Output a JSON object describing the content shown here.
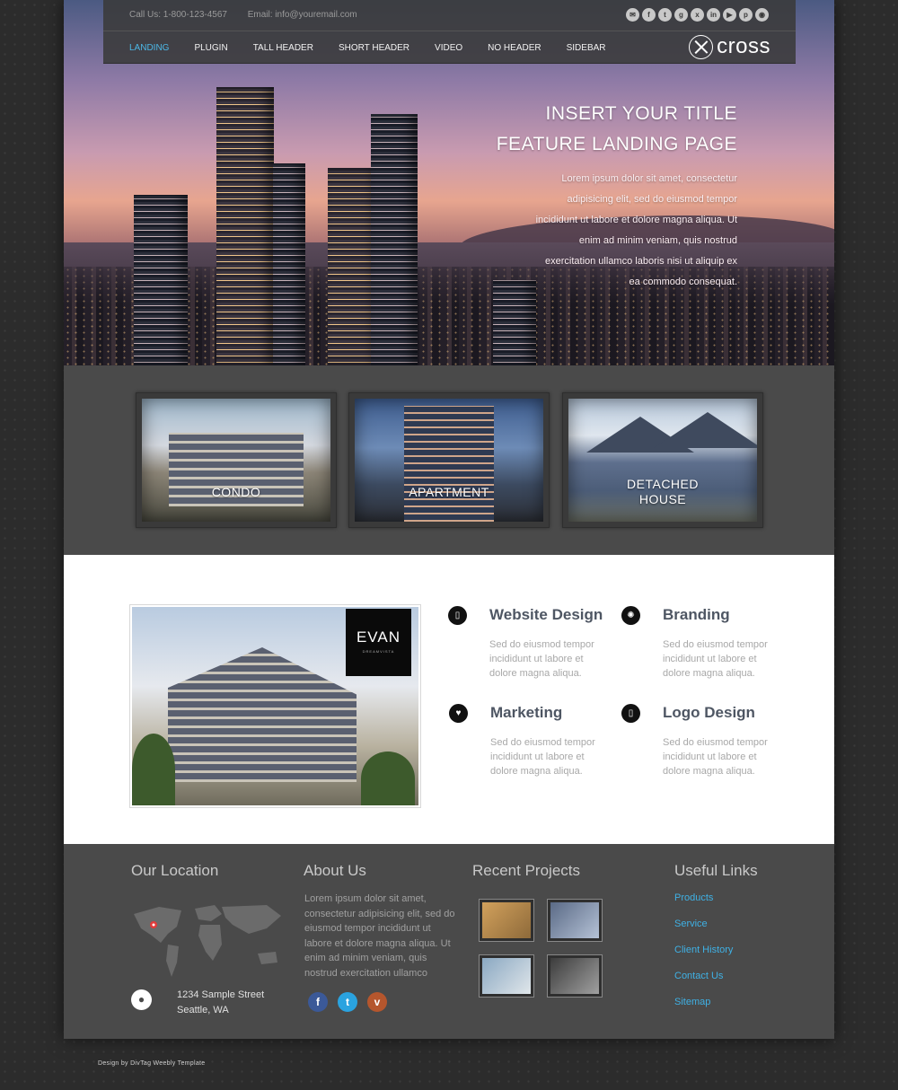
{
  "header": {
    "phone": "Call Us: 1-800-123-4567",
    "email": "Email: info@youremail.com",
    "social_icons": [
      "mail-icon",
      "facebook-icon",
      "twitter-icon",
      "google-plus-icon",
      "xing-icon",
      "linkedin-icon",
      "youtube-icon",
      "pinterest-icon",
      "rss-icon"
    ],
    "nav": [
      {
        "label": "LANDING",
        "active": true
      },
      {
        "label": "PLUGIN"
      },
      {
        "label": "TALL HEADER"
      },
      {
        "label": "SHORT HEADER"
      },
      {
        "label": "VIDEO"
      },
      {
        "label": "NO HEADER"
      },
      {
        "label": "SIDEBAR"
      }
    ],
    "logo": "cross"
  },
  "hero": {
    "title_line1": "INSERT YOUR TITLE",
    "title_line2": "FEATURE LANDING PAGE",
    "body": "Lorem ipsum dolor sit amet, consectetur adipisicing elit, sed do eiusmod tempor incididunt ut labore et dolore magna aliqua. Ut enim ad minim veniam, quis nostrud exercitation ullamco laboris nisi ut aliquip ex ea commodo consequat."
  },
  "categories": [
    {
      "label": "CONDO"
    },
    {
      "label": "APARTMENT"
    },
    {
      "label_line1": "DETACHED",
      "label_line2": "HOUSE"
    }
  ],
  "services": {
    "photo_sign": "EVAN",
    "photo_sign_sub": "DREAMVISTA",
    "items": [
      {
        "title": "Website Design",
        "icon": "mobile-icon",
        "text": "Sed do eiusmod tempor incididunt ut labore et dolore magna aliqua."
      },
      {
        "title": "Branding",
        "icon": "gear-icon",
        "text": "Sed do eiusmod tempor incididunt ut labore et dolore magna aliqua."
      },
      {
        "title": "Marketing",
        "icon": "heart-icon",
        "text": "Sed do eiusmod tempor incididunt ut labore et dolore magna aliqua."
      },
      {
        "title": "Logo Design",
        "icon": "phone-icon",
        "text": "Sed do eiusmod tempor incididunt ut labore et dolore magna aliqua."
      }
    ]
  },
  "footer": {
    "location_title": "Our Location",
    "address_line1": "1234 Sample Street",
    "address_line2": "Seattle, WA",
    "about_title": "About Us",
    "about_text": "Lorem ipsum dolor sit amet, consectetur adipisicing elit, sed do eiusmod tempor incididunt ut labore et dolore magna aliqua. Ut enim ad minim veniam, quis nostrud exercitation ullamco",
    "about_social": [
      "facebook-icon",
      "twitter-icon",
      "vimeo-icon"
    ],
    "projects_title": "Recent Projects",
    "links_title": "Useful Links",
    "links": [
      "Products",
      "Service",
      "Client History",
      "Contact Us",
      "Sitemap"
    ]
  },
  "credit": "Design  by  DivTag  Weebly  Template",
  "colors": {
    "accent": "#4cb8e6",
    "link": "#3fb1e5",
    "panel": "#4a4a4a",
    "background": "#2c2c2c"
  }
}
